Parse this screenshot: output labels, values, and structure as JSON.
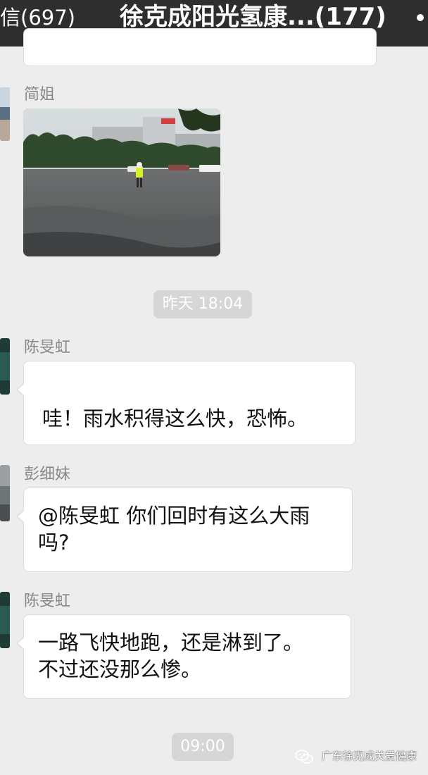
{
  "header": {
    "back_label": "信(697)",
    "title": "徐克成阳光氢康...(177)"
  },
  "messages": [
    {
      "sender": "简姐",
      "type": "image",
      "image_desc": "flooded-street-photo"
    },
    {
      "time": "昨天 18:04"
    },
    {
      "sender": "陈旻虹",
      "text": "哇！雨水积得这么快，恐怖。"
    },
    {
      "sender": "彭细妹",
      "text_line1": "@陈旻虹 你们回时有这么大雨",
      "text_line2": "吗?"
    },
    {
      "sender": "陈旻虹",
      "text_line1": "一路飞快地跑，还是淋到了。",
      "text_line2": "不过还没那么惨。"
    },
    {
      "time": "09:00"
    }
  ],
  "watermark": {
    "text": "广东徐克成关爱健康"
  },
  "colors": {
    "header_bg": "#2e2e2e",
    "chat_bg": "#ededed",
    "bubble_bg": "#ffffff",
    "time_pill_bg": "#d6d6d6"
  }
}
